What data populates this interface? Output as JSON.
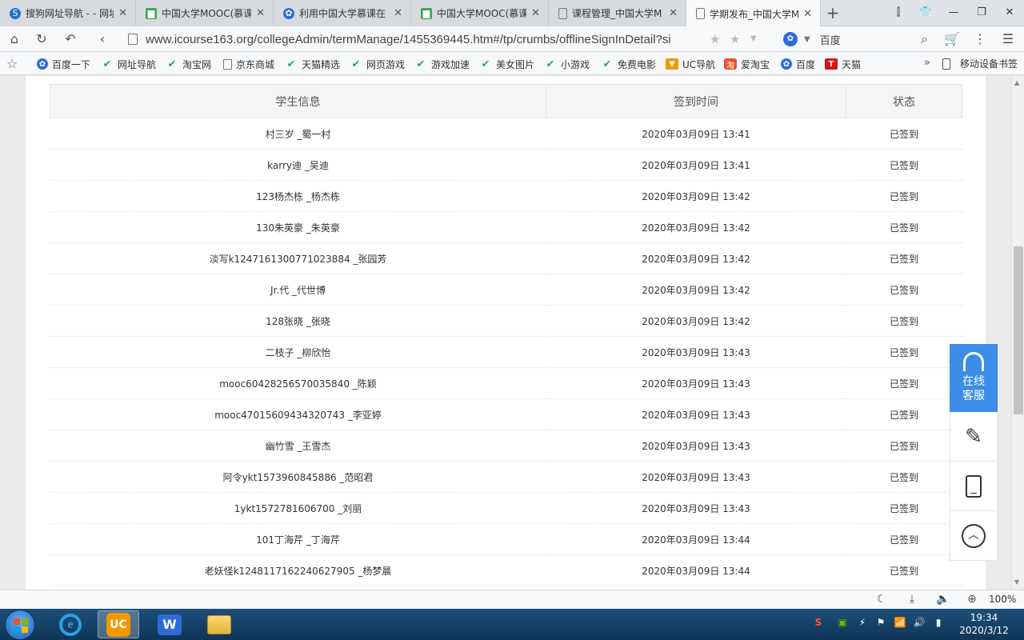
{
  "browser": {
    "tabs": [
      {
        "label": "搜狗网址导航 - - 网址",
        "icon": "sogou-icon",
        "active": false
      },
      {
        "label": "中国大学MOOC(慕课",
        "icon": "book-icon",
        "active": false
      },
      {
        "label": "利用中国大学慕课在",
        "icon": "baidu-paw-icon",
        "active": false
      },
      {
        "label": "中国大学MOOC(慕课",
        "icon": "book-icon",
        "active": false
      },
      {
        "label": "课程管理_中国大学M",
        "icon": "document-icon",
        "active": false
      },
      {
        "label": "学期发布_中国大学M",
        "icon": "document-icon",
        "active": true
      }
    ],
    "url": "www.icourse163.org/collegeAdmin/termManage/1455369445.htm#/tp/crumbs/offlineSignInDetail?si",
    "search_engine": "百度",
    "bookmarks": [
      {
        "label": "百度一下",
        "icon": "baidu"
      },
      {
        "label": "网址导航",
        "icon": "hao"
      },
      {
        "label": "淘宝网",
        "icon": "hao"
      },
      {
        "label": "京东商城",
        "icon": "file"
      },
      {
        "label": "天猫精选",
        "icon": "hao"
      },
      {
        "label": "网页游戏",
        "icon": "hao"
      },
      {
        "label": "游戏加速",
        "icon": "hao"
      },
      {
        "label": "美女图片",
        "icon": "hao"
      },
      {
        "label": "小游戏",
        "icon": "hao"
      },
      {
        "label": "免费电影",
        "icon": "hao"
      },
      {
        "label": "UC导航",
        "icon": "uc"
      },
      {
        "label": "爱淘宝",
        "icon": "aitao"
      },
      {
        "label": "百度",
        "icon": "baidu"
      },
      {
        "label": "天猫",
        "icon": "tmall"
      }
    ],
    "bookmarks_more": "»",
    "mobile_bookmarks": "移动设备书签",
    "zoom": "100%"
  },
  "table": {
    "headers": [
      "学生信息",
      "签到时间",
      "状态"
    ],
    "rows": [
      [
        "村三岁 _蜀一村",
        "2020年03月09日 13:41",
        "已签到"
      ],
      [
        "karry迪 _吴迪",
        "2020年03月09日 13:41",
        "已签到"
      ],
      [
        "123杨杰栋 _杨杰栋",
        "2020年03月09日 13:42",
        "已签到"
      ],
      [
        "130朱英豪 _朱英豪",
        "2020年03月09日 13:42",
        "已签到"
      ],
      [
        "淡写k1247161300771023884 _张园芳",
        "2020年03月09日 13:42",
        "已签到"
      ],
      [
        "Jr.代 _代世博",
        "2020年03月09日 13:42",
        "已签到"
      ],
      [
        "128张晓 _张晓",
        "2020年03月09日 13:42",
        "已签到"
      ],
      [
        "二枝子 _柳欣怡",
        "2020年03月09日 13:43",
        "已签到"
      ],
      [
        "mooc60428256570035840 _陈颖",
        "2020年03月09日 13:43",
        "已签到"
      ],
      [
        "mooc47015609434320743 _李亚婷",
        "2020年03月09日 13:43",
        "已签到"
      ],
      [
        "幽竹雪 _王雪杰",
        "2020年03月09日 13:43",
        "已签到"
      ],
      [
        "阿令ykt1573960845886 _范昭君",
        "2020年03月09日 13:43",
        "已签到"
      ],
      [
        "1ykt1572781606700 _刘丽",
        "2020年03月09日 13:43",
        "已签到"
      ],
      [
        "101丁海芹 _丁海芹",
        "2020年03月09日 13:44",
        "已签到"
      ],
      [
        "老妖怪k1248117162240627905 _杨梦晨",
        "2020年03月09日 13:44",
        "已签到"
      ]
    ]
  },
  "widget": {
    "customer_service_line1": "在线",
    "customer_service_line2": "客服"
  },
  "taskbar": {
    "time": "19:34",
    "date": "2020/3/12"
  },
  "colors": {
    "accent": "#3b8de8",
    "hao_green": "#2fa84f"
  }
}
